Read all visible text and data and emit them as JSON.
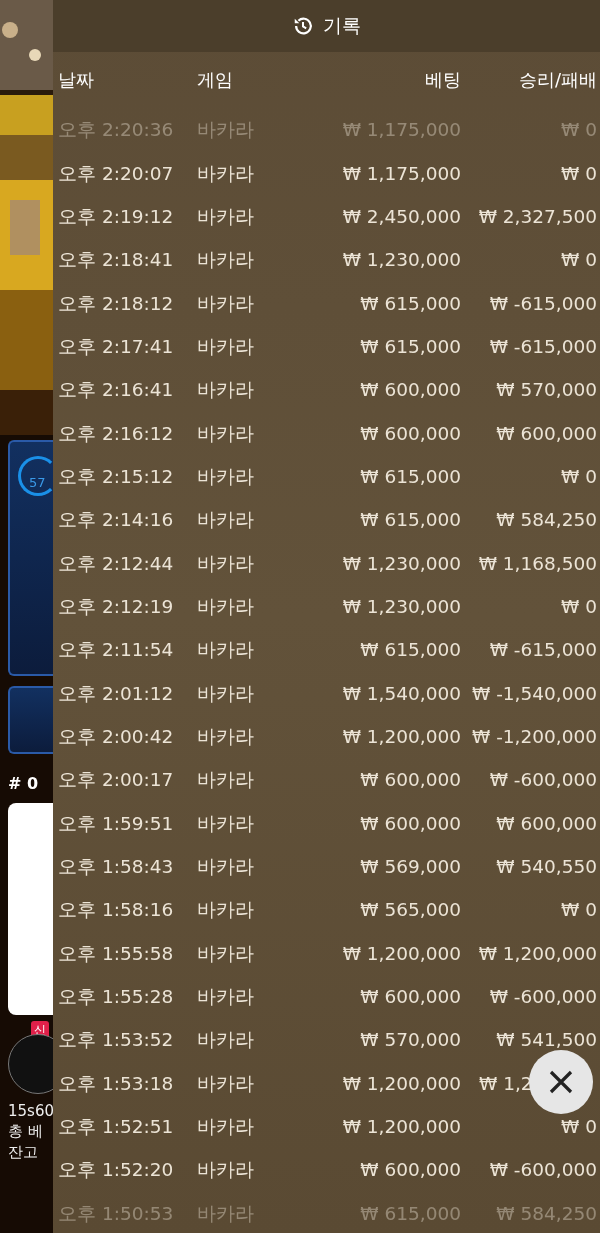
{
  "background": {
    "progress_label": "57",
    "round_label": "# 0",
    "badge": "신",
    "timer_text": "15s60",
    "total_bet_label": "총 베",
    "balance_label": "잔고"
  },
  "history": {
    "title": "기록",
    "columns": [
      "날짜",
      "게임",
      "베팅",
      "승리/패배"
    ],
    "rows": [
      {
        "time": "오후 2:20:36",
        "game": "바카라",
        "bet": "₩ 1,175,000",
        "result": "₩ 0",
        "faded": true
      },
      {
        "time": "오후 2:20:07",
        "game": "바카라",
        "bet": "₩ 1,175,000",
        "result": "₩ 0",
        "faded": false
      },
      {
        "time": "오후 2:19:12",
        "game": "바카라",
        "bet": "₩ 2,450,000",
        "result": "₩ 2,327,500",
        "faded": false
      },
      {
        "time": "오후 2:18:41",
        "game": "바카라",
        "bet": "₩ 1,230,000",
        "result": "₩ 0",
        "faded": false
      },
      {
        "time": "오후 2:18:12",
        "game": "바카라",
        "bet": "₩ 615,000",
        "result": "₩ -615,000",
        "faded": false
      },
      {
        "time": "오후 2:17:41",
        "game": "바카라",
        "bet": "₩ 615,000",
        "result": "₩ -615,000",
        "faded": false
      },
      {
        "time": "오후 2:16:41",
        "game": "바카라",
        "bet": "₩ 600,000",
        "result": "₩ 570,000",
        "faded": false
      },
      {
        "time": "오후 2:16:12",
        "game": "바카라",
        "bet": "₩ 600,000",
        "result": "₩ 600,000",
        "faded": false
      },
      {
        "time": "오후 2:15:12",
        "game": "바카라",
        "bet": "₩ 615,000",
        "result": "₩ 0",
        "faded": false
      },
      {
        "time": "오후 2:14:16",
        "game": "바카라",
        "bet": "₩ 615,000",
        "result": "₩ 584,250",
        "faded": false
      },
      {
        "time": "오후 2:12:44",
        "game": "바카라",
        "bet": "₩ 1,230,000",
        "result": "₩ 1,168,500",
        "faded": false
      },
      {
        "time": "오후 2:12:19",
        "game": "바카라",
        "bet": "₩ 1,230,000",
        "result": "₩ 0",
        "faded": false
      },
      {
        "time": "오후 2:11:54",
        "game": "바카라",
        "bet": "₩ 615,000",
        "result": "₩ -615,000",
        "faded": false
      },
      {
        "time": "오후 2:01:12",
        "game": "바카라",
        "bet": "₩ 1,540,000",
        "result": "₩ -1,540,000",
        "faded": false
      },
      {
        "time": "오후 2:00:42",
        "game": "바카라",
        "bet": "₩ 1,200,000",
        "result": "₩ -1,200,000",
        "faded": false
      },
      {
        "time": "오후 2:00:17",
        "game": "바카라",
        "bet": "₩ 600,000",
        "result": "₩ -600,000",
        "faded": false
      },
      {
        "time": "오후 1:59:51",
        "game": "바카라",
        "bet": "₩ 600,000",
        "result": "₩ 600,000",
        "faded": false
      },
      {
        "time": "오후 1:58:43",
        "game": "바카라",
        "bet": "₩ 569,000",
        "result": "₩ 540,550",
        "faded": false
      },
      {
        "time": "오후 1:58:16",
        "game": "바카라",
        "bet": "₩ 565,000",
        "result": "₩ 0",
        "faded": false
      },
      {
        "time": "오후 1:55:58",
        "game": "바카라",
        "bet": "₩ 1,200,000",
        "result": "₩ 1,200,000",
        "faded": false
      },
      {
        "time": "오후 1:55:28",
        "game": "바카라",
        "bet": "₩ 600,000",
        "result": "₩ -600,000",
        "faded": false
      },
      {
        "time": "오후 1:53:52",
        "game": "바카라",
        "bet": "₩ 570,000",
        "result": "₩ 541,500",
        "faded": false
      },
      {
        "time": "오후 1:53:18",
        "game": "바카라",
        "bet": "₩ 1,200,000",
        "result": "₩ 1,2",
        "faded": false,
        "clipped": true
      },
      {
        "time": "오후 1:52:51",
        "game": "바카라",
        "bet": "₩ 1,200,000",
        "result": "₩ 0",
        "faded": false
      },
      {
        "time": "오후 1:52:20",
        "game": "바카라",
        "bet": "₩ 600,000",
        "result": "₩ -600,000",
        "faded": false
      },
      {
        "time": "오후 1:50:53",
        "game": "바카라",
        "bet": "₩ 615,000",
        "result": "₩ 584,250",
        "faded": true
      }
    ]
  }
}
